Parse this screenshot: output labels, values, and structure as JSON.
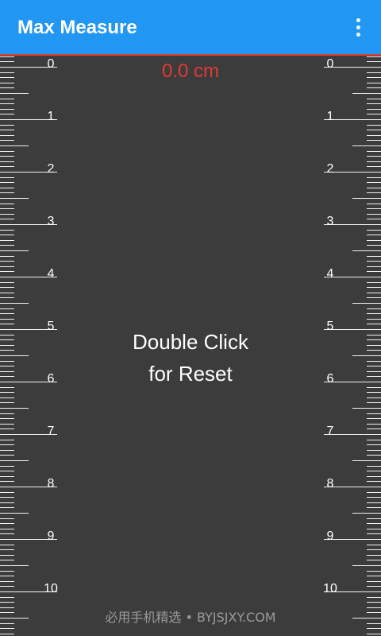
{
  "app_bar": {
    "title": "Max Measure",
    "menu_icon": "overflow-menu-icon",
    "background_color": "#2196f3",
    "title_color": "#ffffff"
  },
  "measurement": {
    "value_text": "0.0 cm",
    "color": "#e53935"
  },
  "reset_hint": {
    "line1": "Double Click",
    "line2": "for Reset"
  },
  "rulers": {
    "unit": "cm",
    "labels": [
      "0",
      "1",
      "2",
      "3",
      "4",
      "5",
      "6",
      "7",
      "8",
      "9",
      "10"
    ],
    "subdivisions_per_unit": 10
  },
  "watermark": "必用手机精选 • BYJSJXY.COM",
  "colors": {
    "background": "#3c3c3c",
    "tick": "#f2f2f2",
    "label": "#ffffff"
  }
}
